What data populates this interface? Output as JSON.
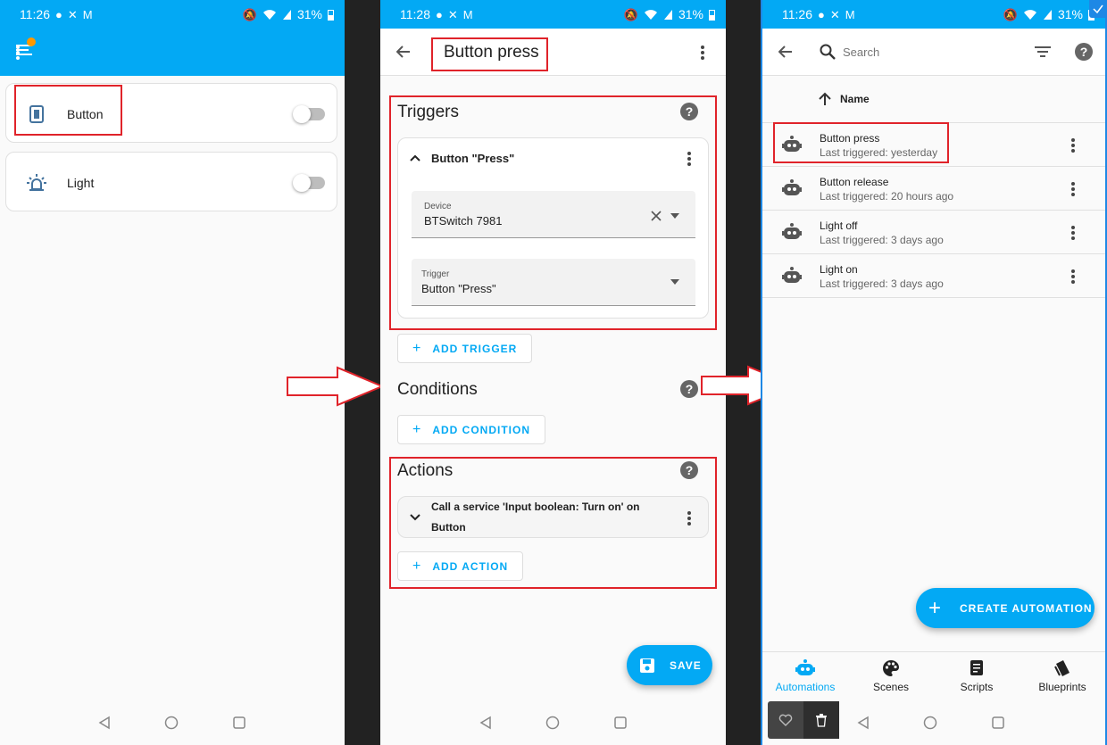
{
  "panel1": {
    "status": {
      "time": "11:26",
      "battery": "31%"
    },
    "entities": [
      {
        "name": "Button",
        "icon": "switch-icon"
      },
      {
        "name": "Light",
        "icon": "alarm-light-icon"
      }
    ]
  },
  "panel2": {
    "status": {
      "time": "11:28",
      "battery": "31%"
    },
    "title": "Button press",
    "triggers": {
      "heading": "Triggers",
      "item_title": "Button \"Press\"",
      "device_label": "Device",
      "device_value": "BTSwitch 7981",
      "trigger_label": "Trigger",
      "trigger_value": "Button \"Press\"",
      "add_label": "ADD TRIGGER"
    },
    "conditions": {
      "heading": "Conditions",
      "add_label": "ADD CONDITION"
    },
    "actions": {
      "heading": "Actions",
      "item_line1": "Call a service 'Input boolean: Turn on' on",
      "item_line2": "Button",
      "add_label": "ADD ACTION"
    },
    "save_label": "SAVE"
  },
  "panel3": {
    "status": {
      "time": "11:26",
      "battery": "31%"
    },
    "search_placeholder": "Search",
    "sort_label": "Name",
    "automations": [
      {
        "name": "Button press",
        "last": "Last triggered: yesterday"
      },
      {
        "name": "Button release",
        "last": "Last triggered: 20 hours ago"
      },
      {
        "name": "Light off",
        "last": "Last triggered: 3 days ago"
      },
      {
        "name": "Light on",
        "last": "Last triggered: 3 days ago"
      }
    ],
    "create_label": "CREATE AUTOMATION",
    "bottom_nav": [
      "Automations",
      "Scenes",
      "Scripts",
      "Blueprints"
    ]
  },
  "colors": {
    "accent": "#03a9f4",
    "highlight": "#e0232a",
    "dark": "#222222"
  }
}
